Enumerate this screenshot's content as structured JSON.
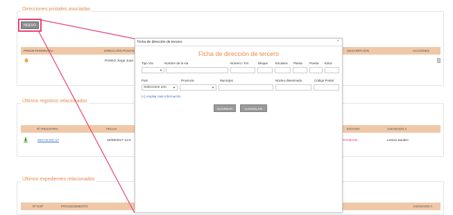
{
  "sections": {
    "direcciones": {
      "legend": "Direcciones postales asociadas",
      "new_button": "NUEVO",
      "headers": [
        "PREDETERMINADA",
        "DIRECCIÓN POSTAL",
        "DESCRIPCIÓN",
        "ACCIONES"
      ],
      "row": {
        "address": "PASEO Jorge Juan"
      }
    },
    "registros": {
      "legend": "Últimos registros relacionados",
      "headers": [
        "Nº REGISTRO",
        "FECHA",
        "ESTADO",
        "ASIGNADO A"
      ],
      "row": {
        "number": "2017-E-RC-17",
        "date": "10/08/2017 12:0",
        "state": "Pendiente",
        "assigned": "Leticia Sandro"
      }
    },
    "expedientes": {
      "legend": "Últimos expedientes relacionados",
      "headers": [
        "Nº EXP",
        "PROCEDIMIENTO",
        "ASIGNADO A"
      ]
    }
  },
  "dialog": {
    "window_title": "Ficha de dirección de tercero",
    "close": "×",
    "heading": "Ficha de dirección de tercero",
    "labels": {
      "tipo_via": "Tipo Vía",
      "nombre_via": "Nombre de la vía",
      "numero": "Número / Km",
      "bloque": "Bloque",
      "escalera": "Escalera",
      "planta": "Planta",
      "puerta": "Puerta",
      "extra": "Extra",
      "pais": "País",
      "provincia": "Provincia",
      "municipio": "Municipio",
      "nucleo": "Núcleo diseminado",
      "codigo_postal": "Código Postal"
    },
    "pais_value": "Seleccione uno",
    "more_info_link": "[+] Ampliar más información",
    "save_button": "GUARDAR",
    "cancel_button": "CANCELAR"
  },
  "colors": {
    "accent": "#e28b52",
    "highlight": "#e8416e",
    "header_bg": "#f0c8a8"
  }
}
